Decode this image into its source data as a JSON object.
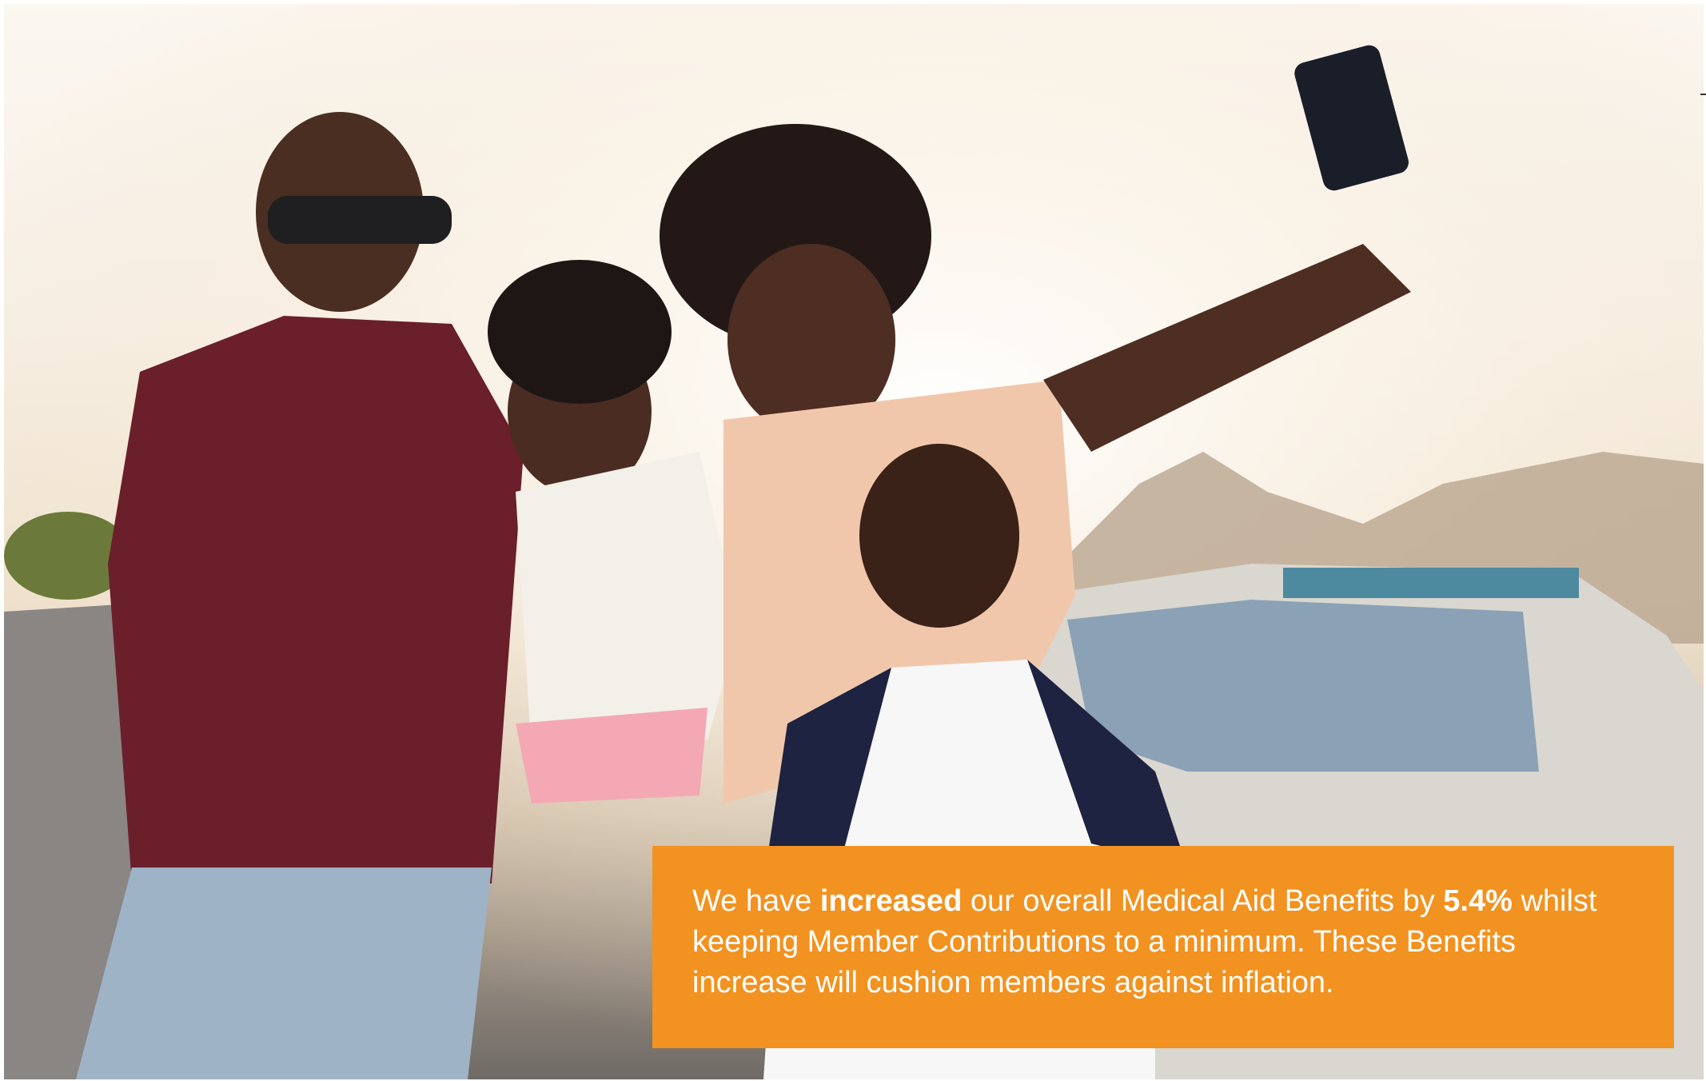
{
  "photo": {
    "description_icon": "family-selfie-photo"
  },
  "callout": {
    "text_1": "We have ",
    "bold_1": "increased",
    "text_2": " our overall Medical Aid Benefits by ",
    "bold_2": "5.4%",
    "text_3": " whilst keeping Member Contributions to a minimum. These Benefits increase will cushion members against inflation.",
    "background_color": "#f29220"
  }
}
